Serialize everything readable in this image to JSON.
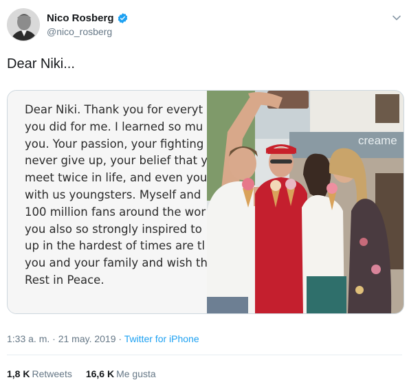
{
  "tweet": {
    "author": {
      "display_name": "Nico Rosberg",
      "handle": "@nico_rosberg",
      "verified": true
    },
    "text": "Dear Niki...",
    "media": {
      "letter_lines": [
        "Dear Niki. Thank you for everyt",
        "you did for me. I learned so mu",
        "you. Your passion, your fighting",
        "never give up, your belief that y",
        "meet twice in life, and even you",
        "with us youngsters. Myself and",
        "100 million fans around the wor",
        "you also so strongly inspired to",
        "up in the hardest of times are tl",
        "you and your family and wish th",
        "Rest in Peace."
      ],
      "photo_sign_text": "creame"
    },
    "timestamp": "1:33 a. m. · 21 may. 2019 ·",
    "source": "Twitter for iPhone",
    "stats": {
      "retweets_count": "1,8 K",
      "retweets_label": "Retweets",
      "likes_count": "16,6 K",
      "likes_label": "Me gusta"
    }
  },
  "colors": {
    "accent": "#1da1f2",
    "secondary_text": "#657786",
    "primary_text": "#14171a"
  },
  "icons": {
    "verified": "verified-badge-icon",
    "menu": "chevron-down-icon"
  }
}
